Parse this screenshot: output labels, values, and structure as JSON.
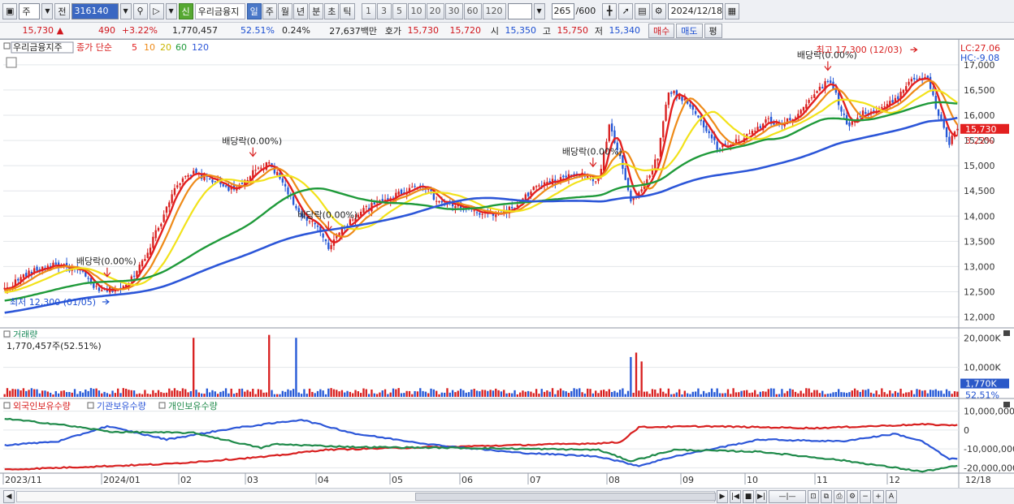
{
  "toolbar": {
    "type_label": "주",
    "prev_label": "전",
    "stock_code": "316140",
    "credit_badge": "신",
    "stock_name": "우리금융지",
    "periods": [
      "일",
      "주",
      "월",
      "년",
      "분",
      "초",
      "틱"
    ],
    "selected_period": "일",
    "intervals": [
      "1",
      "3",
      "5",
      "10",
      "20",
      "30",
      "60",
      "120"
    ],
    "count_value": "265",
    "count_total": "/600",
    "date_value": "2024/12/18"
  },
  "quote": {
    "price": "15,730",
    "arrow": "▲",
    "change": "490",
    "change_pct": "+3.22%",
    "volume": "1,770,457",
    "vol_ratio": "52.51%",
    "turnover": "0.24%",
    "amount": "27,637백만",
    "bid_label": "호가",
    "ask1": "15,730",
    "bid1": "15,720",
    "open_label": "시",
    "open": "15,350",
    "high_label": "고",
    "high": "15,750",
    "low_label": "저",
    "low": "15,340",
    "buy_label": "매수",
    "sell_label": "매도",
    "eval_label": "평"
  },
  "price_panel": {
    "legend_name": "우리금융지주",
    "legend_type": "종가 단순",
    "ma_periods": [
      "5",
      "10",
      "20",
      "60",
      "120"
    ],
    "ma_colors": [
      "#e32020",
      "#ee8a18",
      "#f2e21a",
      "#1f9a3a",
      "#2c56d8"
    ],
    "lc_label": "LC:27.06",
    "hc_label": "HC:-9.08",
    "current_price_label": "15,730",
    "current_pct_label": "3.22%",
    "y_ticks": [
      "17,000",
      "16,500",
      "16,000",
      "15,500",
      "15,000",
      "14,500",
      "14,000",
      "13,500",
      "13,000",
      "12,500",
      "12,000"
    ],
    "annotations": [
      {
        "text": "배당락(0.00%)",
        "date": "2023/12"
      },
      {
        "text": "배당락(0.00%)",
        "date": "2024/02"
      },
      {
        "text": "배당락(0.00%)",
        "date": "2024/03"
      },
      {
        "text": "배당락(0.00%)",
        "date": "2024/06"
      },
      {
        "text": "배당락(0.00%)",
        "date": "2024/09"
      }
    ],
    "high_note": "최고 17,300 (12/03)",
    "low_note": "최저 12,300 (01/05)"
  },
  "volume_panel": {
    "title": "거래량",
    "value": "1,770,457주(52.51%)",
    "y_ticks": [
      "20,000K",
      "10,000K"
    ],
    "current_label": "1,770K",
    "current_pct": "52.51%"
  },
  "investor_panel": {
    "legend": [
      "외국인보유수량",
      "기관보유수량",
      "개인보유수량"
    ],
    "colors": [
      "#d81f1f",
      "#2c56d8",
      "#1f8a4a"
    ],
    "y_ticks": [
      "10,000,000",
      "0",
      "-10,000,000",
      "-20,000,000"
    ]
  },
  "x_axis": {
    "labels": [
      "2023/11",
      "2024/01",
      "02",
      "03",
      "04",
      "05",
      "06",
      "07",
      "08",
      "09",
      "10",
      "11",
      "12"
    ],
    "right_label": "12/18"
  },
  "chart_data": {
    "type": "candlestick",
    "ylim": [
      11800,
      17400
    ],
    "ohlc_start": "2023-11-23",
    "closes_keypoints": [
      [
        0,
        12550
      ],
      [
        8,
        12850
      ],
      [
        18,
        13050
      ],
      [
        28,
        12900
      ],
      [
        35,
        12500
      ],
      [
        45,
        12600
      ],
      [
        52,
        13200
      ],
      [
        58,
        13900
      ],
      [
        63,
        14600
      ],
      [
        70,
        14850
      ],
      [
        78,
        14700
      ],
      [
        85,
        14500
      ],
      [
        92,
        14850
      ],
      [
        98,
        15050
      ],
      [
        104,
        14600
      ],
      [
        110,
        13950
      ],
      [
        116,
        13800
      ],
      [
        120,
        13400
      ],
      [
        126,
        13800
      ],
      [
        132,
        14100
      ],
      [
        140,
        14300
      ],
      [
        148,
        14500
      ],
      [
        155,
        14650
      ],
      [
        160,
        14300
      ],
      [
        168,
        14200
      ],
      [
        176,
        14050
      ],
      [
        183,
        14050
      ],
      [
        190,
        14200
      ],
      [
        196,
        14550
      ],
      [
        204,
        14700
      ],
      [
        212,
        14850
      ],
      [
        220,
        14700
      ],
      [
        224,
        15800
      ],
      [
        228,
        15200
      ],
      [
        232,
        14300
      ],
      [
        236,
        14500
      ],
      [
        242,
        15200
      ],
      [
        246,
        16500
      ],
      [
        252,
        16300
      ],
      [
        258,
        15900
      ],
      [
        264,
        15350
      ],
      [
        270,
        15450
      ],
      [
        276,
        15600
      ],
      [
        282,
        15900
      ],
      [
        288,
        15800
      ],
      [
        294,
        16050
      ],
      [
        300,
        16450
      ],
      [
        306,
        16700
      ],
      [
        312,
        15800
      ],
      [
        318,
        16050
      ],
      [
        324,
        16100
      ],
      [
        330,
        16300
      ],
      [
        336,
        16750
      ],
      [
        342,
        16700
      ],
      [
        346,
        16000
      ],
      [
        350,
        15450
      ],
      [
        353,
        15730
      ]
    ],
    "ma_last": {
      "5": 15700,
      "10": 15900,
      "20": 16150,
      "60": 16150,
      "120": 15700
    },
    "volume_spikes": [
      [
        70,
        20000
      ],
      [
        98,
        21000
      ],
      [
        108,
        20000
      ],
      [
        232,
        13500
      ],
      [
        234,
        15000
      ],
      [
        236,
        12000
      ]
    ],
    "volume_ylim": [
      0,
      22000
    ],
    "investor_ylim": [
      -22000000,
      15000000
    ],
    "foreign_keypoints": [
      [
        0,
        -21000000
      ],
      [
        60,
        -18000000
      ],
      [
        98,
        -14000000
      ],
      [
        118,
        -10500000
      ],
      [
        160,
        -9000000
      ],
      [
        220,
        -7000000
      ],
      [
        228,
        -6500000
      ],
      [
        235,
        1500000
      ],
      [
        260,
        2000000
      ],
      [
        300,
        1000000
      ],
      [
        340,
        3000000
      ],
      [
        353,
        2500000
      ]
    ],
    "institution_keypoints": [
      [
        0,
        -8000000
      ],
      [
        20,
        -6000000
      ],
      [
        38,
        2000000
      ],
      [
        60,
        -5000000
      ],
      [
        85,
        1000000
      ],
      [
        110,
        5500000
      ],
      [
        130,
        -2000000
      ],
      [
        160,
        -8000000
      ],
      [
        190,
        -12000000
      ],
      [
        220,
        -14000000
      ],
      [
        235,
        -19000000
      ],
      [
        248,
        -14000000
      ],
      [
        280,
        -5000000
      ],
      [
        310,
        -6000000
      ],
      [
        330,
        -2000000
      ],
      [
        340,
        -6000000
      ],
      [
        350,
        -15500000
      ],
      [
        353,
        -15000000
      ]
    ],
    "retail_keypoints": [
      [
        0,
        6000000
      ],
      [
        20,
        3000000
      ],
      [
        40,
        -1000000
      ],
      [
        70,
        -1500000
      ],
      [
        95,
        -9500000
      ],
      [
        100,
        -7500000
      ],
      [
        130,
        -9000000
      ],
      [
        170,
        -9500000
      ],
      [
        220,
        -10500000
      ],
      [
        232,
        -16500000
      ],
      [
        248,
        -10500000
      ],
      [
        280,
        -11500000
      ],
      [
        310,
        -16000000
      ],
      [
        340,
        -22000000
      ],
      [
        353,
        -19000000
      ]
    ]
  }
}
